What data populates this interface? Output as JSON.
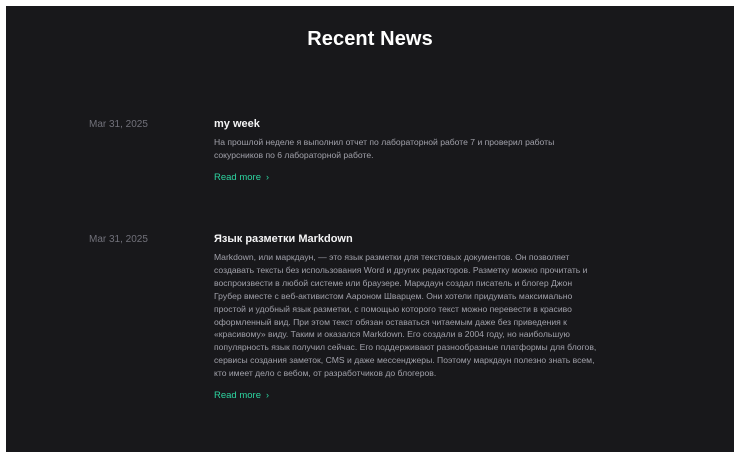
{
  "page": {
    "title": "Recent News"
  },
  "articles": [
    {
      "date": "Mar 31, 2025",
      "title": "my week",
      "summary": "На прошлой неделе я выполнил отчет по лабораторной работе 7 и проверил работы сокурсников по 6 лабораторной работе.",
      "read_more": "Read more"
    },
    {
      "date": "Mar 31, 2025",
      "title": "Язык разметки Markdown",
      "summary": "Markdown, или маркдаун, — это язык разметки для текстовых документов. Он позволяет создавать тексты без использования Word и других редакторов. Разметку можно прочитать и воспроизвести в любой системе или браузере. Маркдаун создал писатель и блогер Джон Грубер вместе с веб-активистом Аароном Шварцем. Они хотели придумать максимально простой и удобный язык разметки, с помощью которого текст можно перевести в красиво оформленный вид. При этом текст обязан оставаться читаемым даже без приведения к «красивому» виду. Таким и оказался Markdown. Его создали в 2004 году, но наибольшую популярность язык получил сейчас. Его поддерживают разнообразные платформы для блогов, сервисы создания заметок, CMS и даже мессенджеры. Поэтому маркдаун полезно знать всем, кто имеет дело с вебом, от разработчиков до блогеров.",
      "read_more": "Read more"
    }
  ],
  "icons": {
    "read_more_chevron": "chevron-right-icon"
  },
  "colors": {
    "background": "#18181b",
    "accent": "#2dd4a0",
    "heading": "#ffffff",
    "muted_text": "#a1a1aa",
    "date_text": "#71717a"
  }
}
